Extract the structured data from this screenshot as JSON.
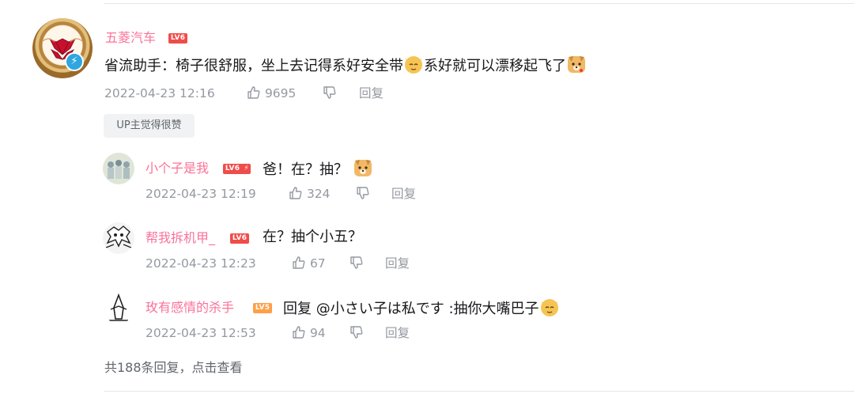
{
  "main_comment": {
    "username": "五菱汽车",
    "level": "LV6",
    "text_before_emoji": "省流助手：椅子很舒服，坐上去记得系好安全带",
    "text_middle": "系好就可以漂移起飞了",
    "timestamp": "2022-04-23 12:16",
    "likes": "9695",
    "reply_label": "回复",
    "up_tag": "UP主觉得很赞",
    "avatar_icon": "wuling-logo-icon",
    "badge_icon": "lightning-verified-icon"
  },
  "replies": [
    {
      "username": "小个子是我",
      "level": "LV6",
      "text": "爸！在？抽？",
      "timestamp": "2022-04-23 12:19",
      "likes": "324",
      "reply_label": "回复"
    },
    {
      "username": "帮我拆机甲_",
      "level": "LV6",
      "text": "在？抽个小五？",
      "timestamp": "2022-04-23 12:23",
      "likes": "67",
      "reply_label": "回复"
    },
    {
      "username": "玫有感情的杀手",
      "level": "LV5",
      "text": "回复 @小さい子は私です :抽你大嘴巴子",
      "timestamp": "2022-04-23 12:53",
      "likes": "94",
      "reply_label": "回复"
    }
  ],
  "footer": {
    "count_text": "共188条回复，",
    "view_link": "点击查看"
  },
  "colors": {
    "username": "#fb7299",
    "meta": "#9499a0",
    "lv6": "#f04c49",
    "lv5": "#ff9f47"
  }
}
